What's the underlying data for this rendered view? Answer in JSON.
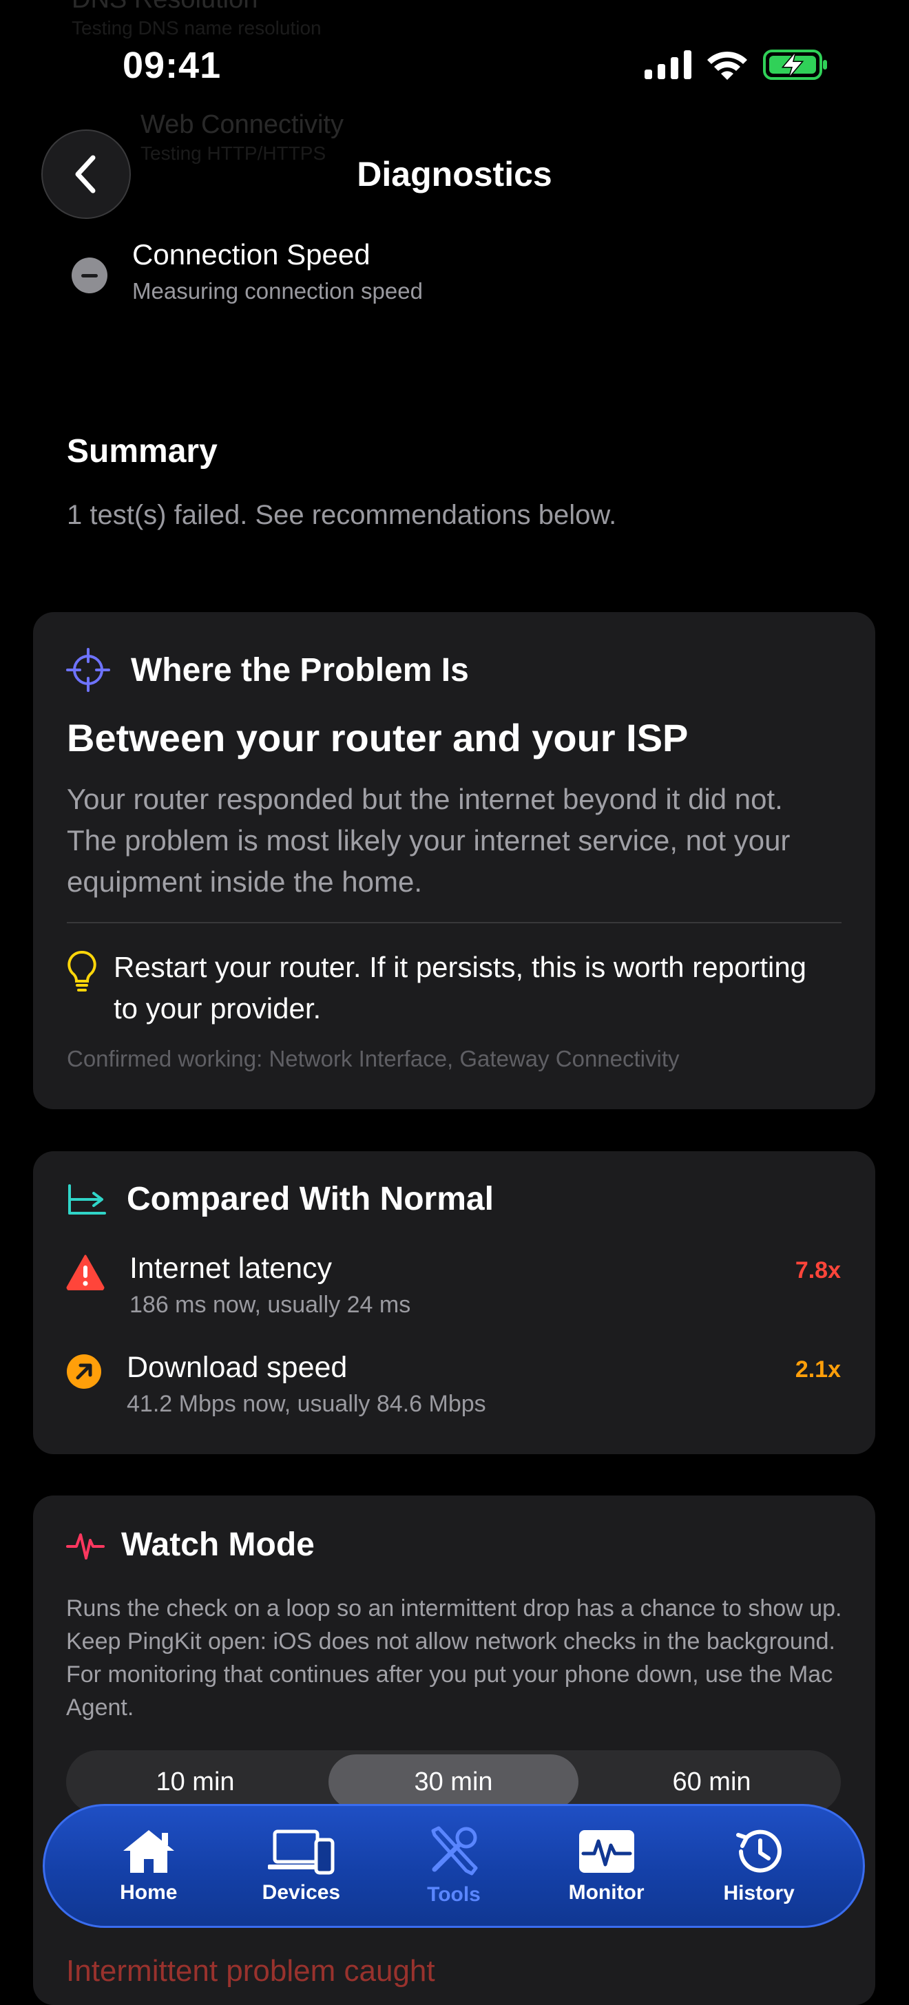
{
  "background_rows": [
    {
      "title": "DNS Resolution",
      "subtitle": "Testing DNS name resolution"
    },
    {
      "title": "Web Connectivity",
      "subtitle": "Testing HTTP/HTTPS"
    }
  ],
  "status_bar": {
    "time": "09:41"
  },
  "header": {
    "title": "Diagnostics"
  },
  "pending_test": {
    "title": "Connection Speed",
    "subtitle": "Measuring connection speed"
  },
  "summary": {
    "heading": "Summary",
    "text": "1 test(s) failed. See recommendations below."
  },
  "problem_card": {
    "heading": "Where the Problem Is",
    "title": "Between your router and your ISP",
    "body": "Your router responded but the internet beyond it did not. The problem is most likely your internet service, not your equipment inside the home.",
    "tip": "Restart your router. If it persists, this is worth reporting to your provider.",
    "footer": "Confirmed working: Network Interface, Gateway Connectivity"
  },
  "compare_card": {
    "heading": "Compared With Normal",
    "metrics": [
      {
        "name": "Internet latency",
        "detail": "186 ms now, usually 24 ms",
        "ratio": "7.8x",
        "color": "#ff453a",
        "icon": "warning-icon"
      },
      {
        "name": "Download speed",
        "detail": "41.2 Mbps now, usually 84.6 Mbps",
        "ratio": "2.1x",
        "color": "#ff9f0a",
        "icon": "arrow-up-right-icon"
      }
    ]
  },
  "watch_card": {
    "heading": "Watch Mode",
    "body": "Runs the check on a loop so an intermittent drop has a chance to show up. Keep PingKit open: iOS does not allow network checks in the background. For monitoring that continues after you put your phone down, use the Mac Agent.",
    "options": [
      "10 min",
      "30 min",
      "60 min"
    ],
    "selected": "30 min"
  },
  "obscured_text": "Intermittent problem caught",
  "tabbar": {
    "tabs": [
      {
        "label": "Home",
        "icon": "house-icon"
      },
      {
        "label": "Devices",
        "icon": "devices-icon"
      },
      {
        "label": "Tools",
        "icon": "tools-icon"
      },
      {
        "label": "Monitor",
        "icon": "waveform-icon"
      },
      {
        "label": "History",
        "icon": "clock-history-icon"
      }
    ],
    "active": "Tools"
  },
  "colors": {
    "accent_blue": "#5a86ff",
    "teal": "#30d5c8",
    "warning_red": "#ff453a",
    "orange": "#ff9f0a",
    "bulb_yellow": "#ffd60a",
    "battery_green": "#30d158",
    "target_purple": "#6e73ff",
    "watch_pink": "#ff375f"
  }
}
